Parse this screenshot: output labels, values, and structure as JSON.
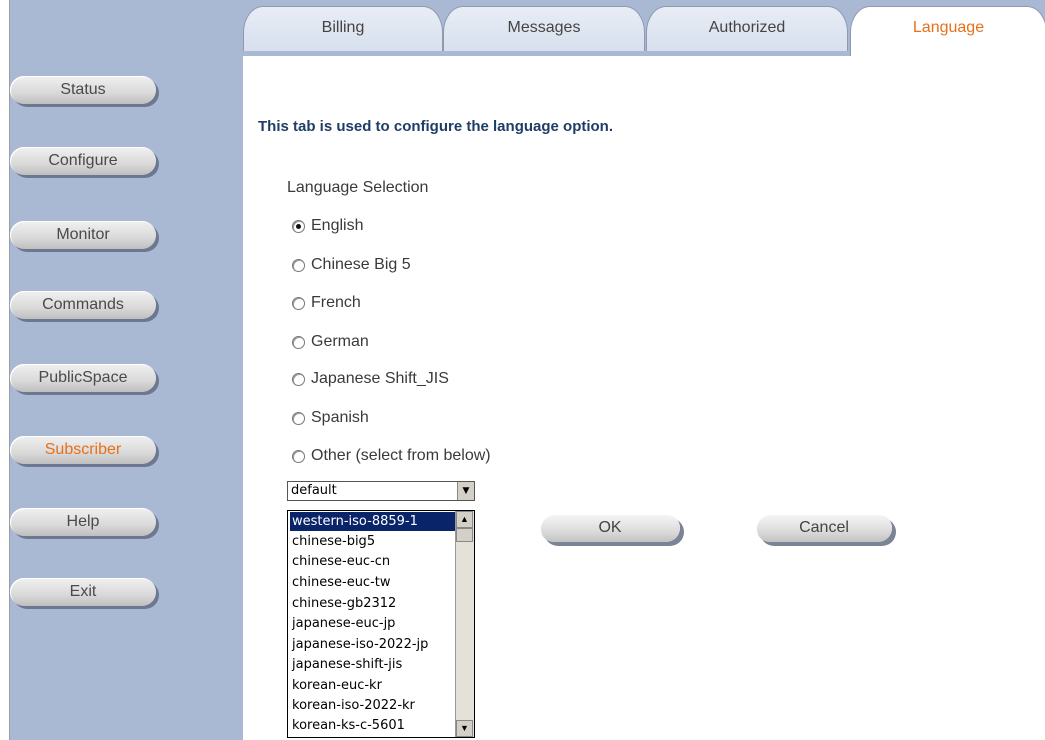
{
  "tabs": [
    {
      "label": "Billing",
      "active": false
    },
    {
      "label": "Messages",
      "active": false
    },
    {
      "label": "Authorized",
      "active": false
    },
    {
      "label": "Language",
      "active": true
    }
  ],
  "sidebar": {
    "items": [
      {
        "label": "Status",
        "active": false
      },
      {
        "label": "Configure",
        "active": false
      },
      {
        "label": "Monitor",
        "active": false
      },
      {
        "label": "Commands",
        "active": false
      },
      {
        "label": "PublicSpace",
        "active": false
      },
      {
        "label": "Subscriber",
        "active": true
      },
      {
        "label": "Help",
        "active": false
      },
      {
        "label": "Exit",
        "active": false
      }
    ]
  },
  "main": {
    "intro": "This tab is used to configure the language option.",
    "section_label": "Language Selection",
    "options": [
      {
        "label": "English",
        "checked": true
      },
      {
        "label": "Chinese Big 5",
        "checked": false
      },
      {
        "label": "French",
        "checked": false
      },
      {
        "label": "German",
        "checked": false
      },
      {
        "label": "Japanese Shift_JIS",
        "checked": false
      },
      {
        "label": "Spanish",
        "checked": false
      },
      {
        "label": "Other (select from below)",
        "checked": false
      }
    ],
    "select_value": "default",
    "dropdown_items": [
      "western-iso-8859-1",
      "chinese-big5",
      "chinese-euc-cn",
      "chinese-euc-tw",
      "chinese-gb2312",
      "japanese-euc-jp",
      "japanese-iso-2022-jp",
      "japanese-shift-jis",
      "korean-euc-kr",
      "korean-iso-2022-kr",
      "korean-ks-c-5601"
    ],
    "dropdown_selected": "western-iso-8859-1",
    "ok_label": "OK",
    "cancel_label": "Cancel"
  },
  "colors": {
    "sidebar_bg": "#aab9d3",
    "active_text": "#e8701a",
    "heading_text": "#1f3d66",
    "selection_bg": "#0a246a"
  }
}
